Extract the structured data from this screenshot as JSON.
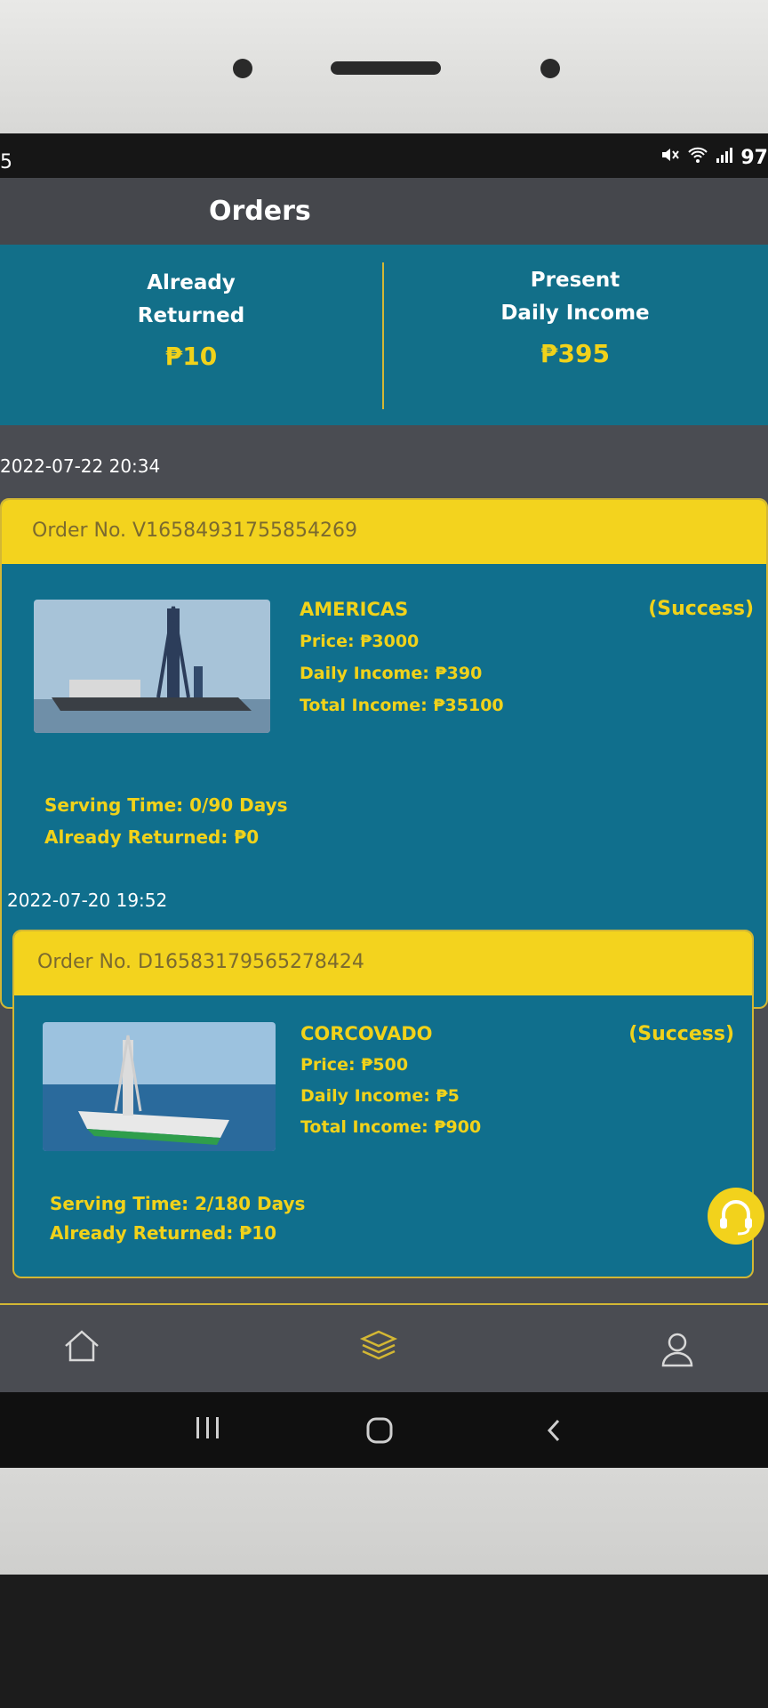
{
  "status_bar": {
    "left_text": "5",
    "right_text": "97"
  },
  "header": {
    "title": "Orders"
  },
  "summary": {
    "returned_label_line1": "Already",
    "returned_label_line2": "Returned",
    "returned_value": "₱10",
    "income_label_line1": "Present",
    "income_label_line2": "Daily Income",
    "income_value": "₱395"
  },
  "orders": [
    {
      "date": "2022-07-22 20:34",
      "order_no": "Order No. V16584931755854269",
      "name": "AMERICAS",
      "status": "(Success)",
      "price": "Price: ₱3000",
      "daily_income": "Daily Income: ₱390",
      "total_income": "Total Income: ₱35100",
      "serving_time": "Serving Time: 0/90 Days",
      "already_returned": "Already Returned: ₱0"
    },
    {
      "date": "2022-07-20 19:52",
      "order_no": "Order No. D16583179565278424",
      "name": "CORCOVADO",
      "status": "(Success)",
      "price": "Price: ₱500",
      "daily_income": "Daily Income: ₱5",
      "total_income": "Total Income: ₱900",
      "serving_time": "Serving Time: 2/180 Days",
      "already_returned": "Already Returned: ₱10"
    }
  ],
  "nav": {
    "items": [
      "home-icon",
      "orders-icon",
      "profile-icon"
    ],
    "active_color": "#d3b734"
  },
  "colors": {
    "accent": "#f1d21a",
    "card": "#106f8d",
    "header": "#f3d31e"
  }
}
